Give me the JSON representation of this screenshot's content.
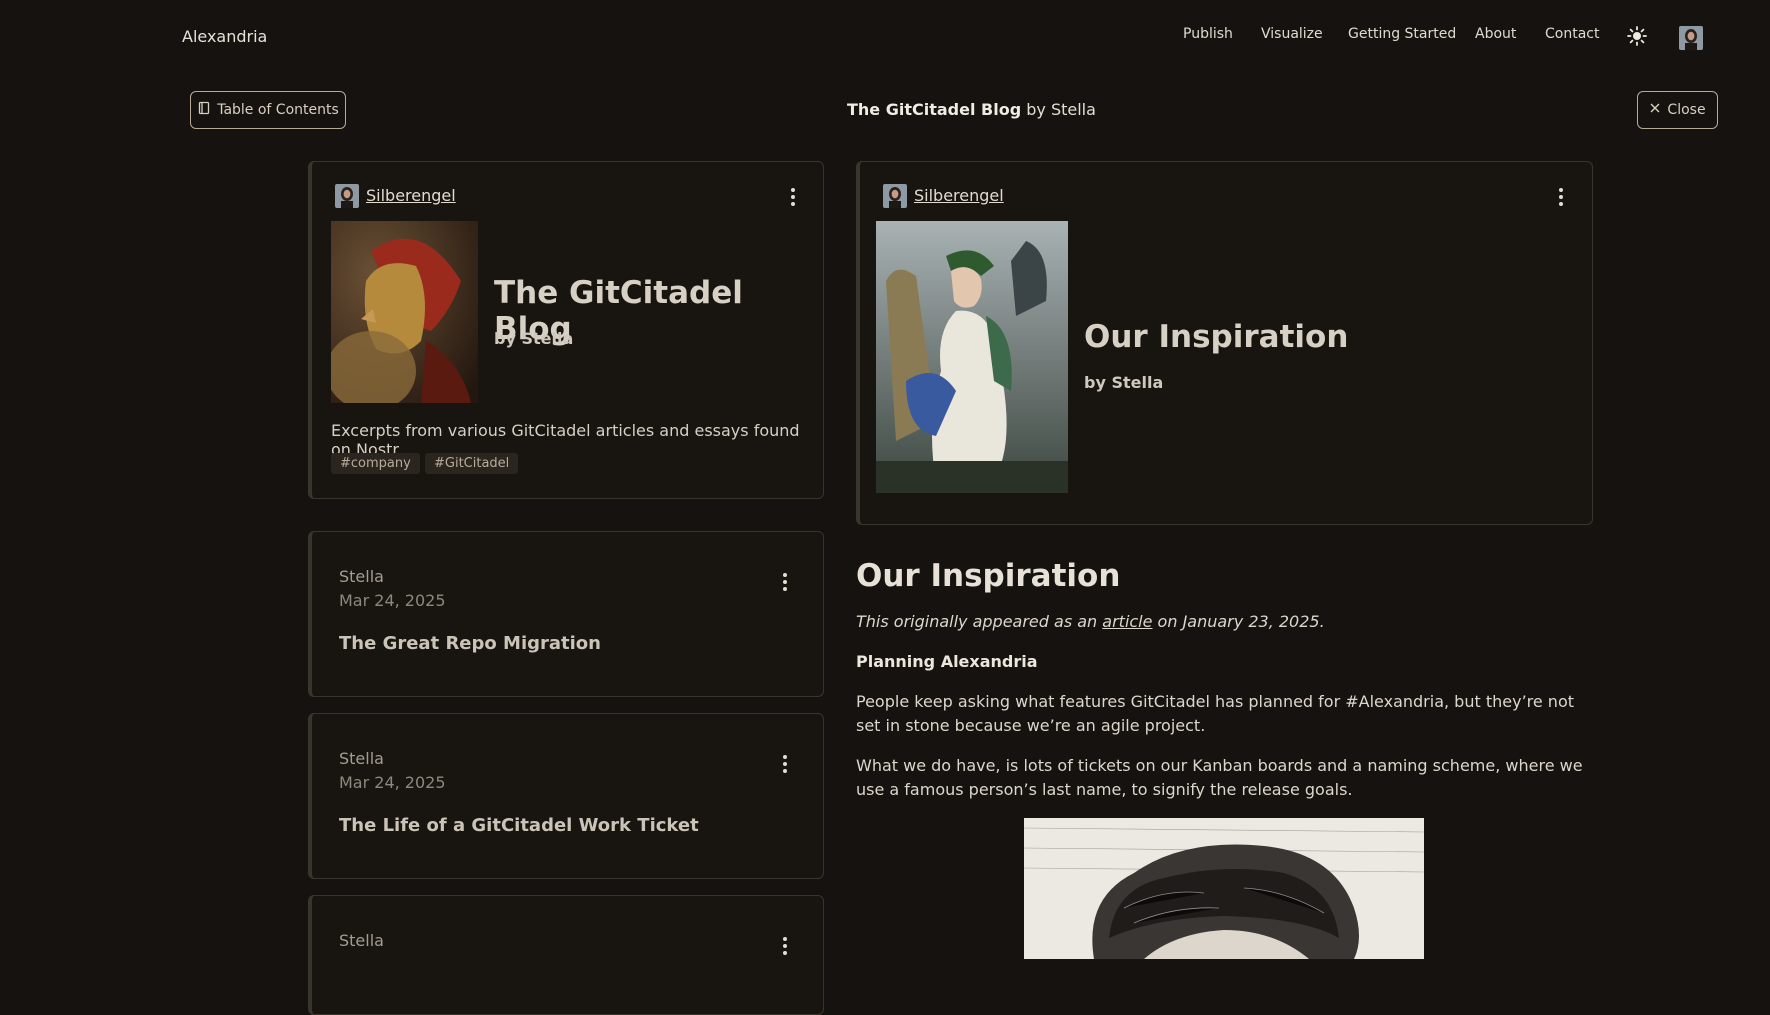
{
  "nav": {
    "brand": "Alexandria",
    "items": [
      {
        "label": "Publish"
      },
      {
        "label": "Visualize"
      },
      {
        "label": "Getting Started"
      },
      {
        "label": "About"
      },
      {
        "label": "Contact"
      }
    ],
    "theme_icon": "sun-icon",
    "avatar_icon": "user-avatar"
  },
  "subheader": {
    "toc_label": "Table of Contents",
    "toc_icon": "book-icon",
    "title_bold": "The GitCitadel Blog",
    "title_rest": " by Stella",
    "close_label": "Close",
    "close_icon": "close-icon"
  },
  "blog_card": {
    "author": "Silberengel",
    "title": "The GitCitadel Blog",
    "byline": "by Stella",
    "description": "Excerpts from various GitCitadel articles and essays found on Nostr.",
    "tags": [
      "#company",
      "#GitCitadel"
    ]
  },
  "list": [
    {
      "author": "Stella",
      "date": "Mar 24, 2025",
      "title": "The Great Repo Migration"
    },
    {
      "author": "Stella",
      "date": "Mar 24, 2025",
      "title": "The Life of a GitCitadel Work Ticket"
    },
    {
      "author": "Stella",
      "date": "",
      "title": ""
    }
  ],
  "detail_card": {
    "author": "Silberengel",
    "title": "Our Inspiration",
    "byline": "by Stella"
  },
  "article": {
    "heading": "Our Inspiration",
    "note_pre": "This originally appeared as an ",
    "note_link": "article",
    "note_post": " on January 23, 2025.",
    "subheading": "Planning Alexandria",
    "para1": "People keep asking what features GitCitadel has planned for #Alexandria, but they’re not set in stone because we’re an agile project.",
    "para2": "What we do have, is lots of tickets on our Kanban boards and a naming scheme, where we use a famous person’s last name, to signify the release goals."
  },
  "colors": {
    "background": "#16120f",
    "border": "#3a342d",
    "text": "#d9d2c8"
  }
}
